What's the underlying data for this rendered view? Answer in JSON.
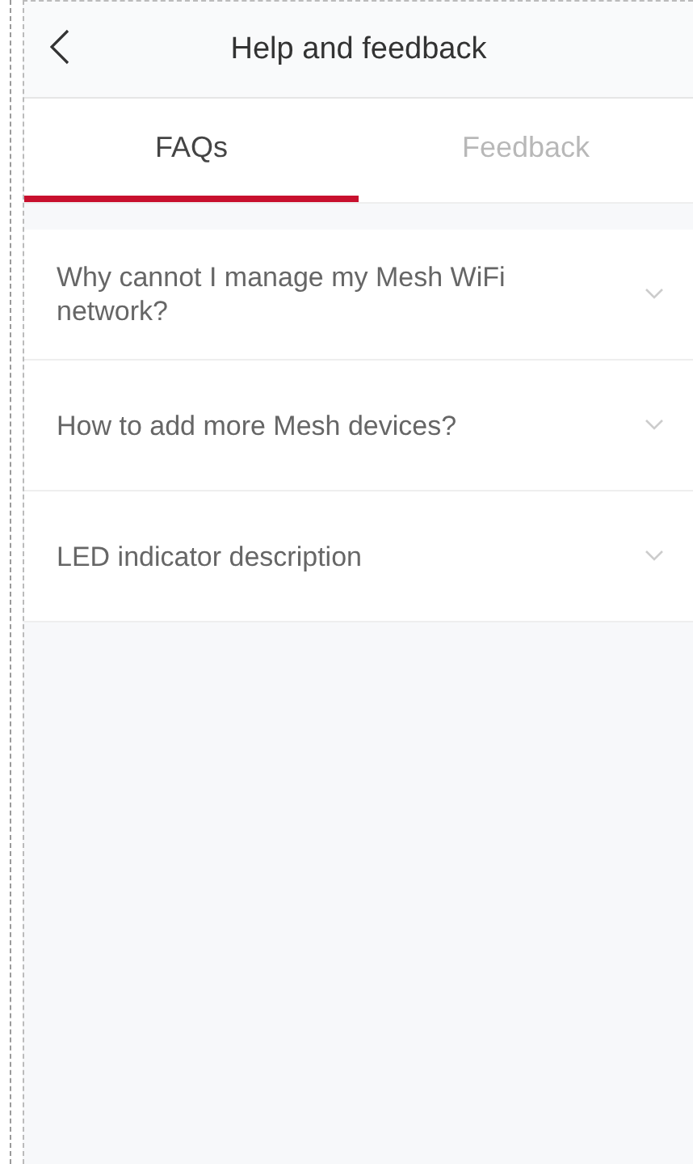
{
  "header": {
    "title": "Help and feedback"
  },
  "tabs": [
    {
      "label": "FAQs",
      "selected": true
    },
    {
      "label": "Feedback",
      "selected": false
    }
  ],
  "faqs": [
    {
      "question": "Why cannot I manage my Mesh WiFi network?",
      "expanded": false
    },
    {
      "question": "How to add more Mesh devices?",
      "expanded": false
    },
    {
      "question": "LED indicator description",
      "expanded": false
    }
  ]
}
